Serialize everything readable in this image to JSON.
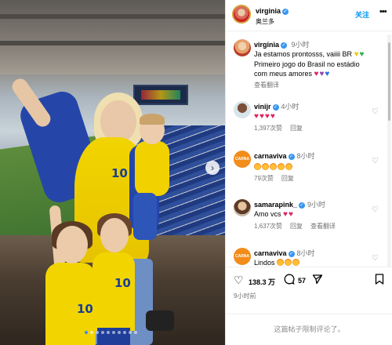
{
  "post": {
    "carousel": {
      "total": 10,
      "active_index": 0
    },
    "next_icon": "chevron-right-icon"
  },
  "header": {
    "username": "virginia",
    "location": "奥兰多",
    "follow_label": "关注",
    "more_icon": "more-horizontal-icon"
  },
  "caption": {
    "username": "virginia",
    "time": "9小时",
    "lines": [
      "Ja estamos prontosss, vaiiii BR",
      "Primeiro jogo do Brasil no estádio",
      "com meus amores"
    ],
    "translate_label": "查看翻译"
  },
  "comments": [
    {
      "username": "vinijr",
      "time": "4小时",
      "emoji_count": 4,
      "emoji": "red-heart",
      "likes": "1,397次赞",
      "reply": "回复"
    },
    {
      "username": "carnaviva",
      "time": "8小时",
      "emoji_count": 5,
      "emoji": "heart-eyes-face",
      "likes": "79次赞",
      "reply": "回复"
    },
    {
      "username": "samarapink_",
      "time": "9小时",
      "text": "Amo vcs",
      "emoji_count": 2,
      "emoji": "red-heart",
      "likes": "1,637次赞",
      "reply": "回复",
      "translate": "查看翻译"
    },
    {
      "username": "carnaviva",
      "time": "8小时",
      "text": "Lindos",
      "emoji_count": 3,
      "emoji": "heart-eyes-face"
    }
  ],
  "actions": {
    "like_count": "138.3 万",
    "comment_count": "57",
    "time_ago": "9小时前"
  },
  "footer": {
    "limited_text": "这篇帖子限制评论了。"
  },
  "colors": {
    "link_blue": "#0095f6",
    "verified_blue": "#3897f0",
    "heart_red": "#e0245e",
    "muted": "#737373"
  }
}
